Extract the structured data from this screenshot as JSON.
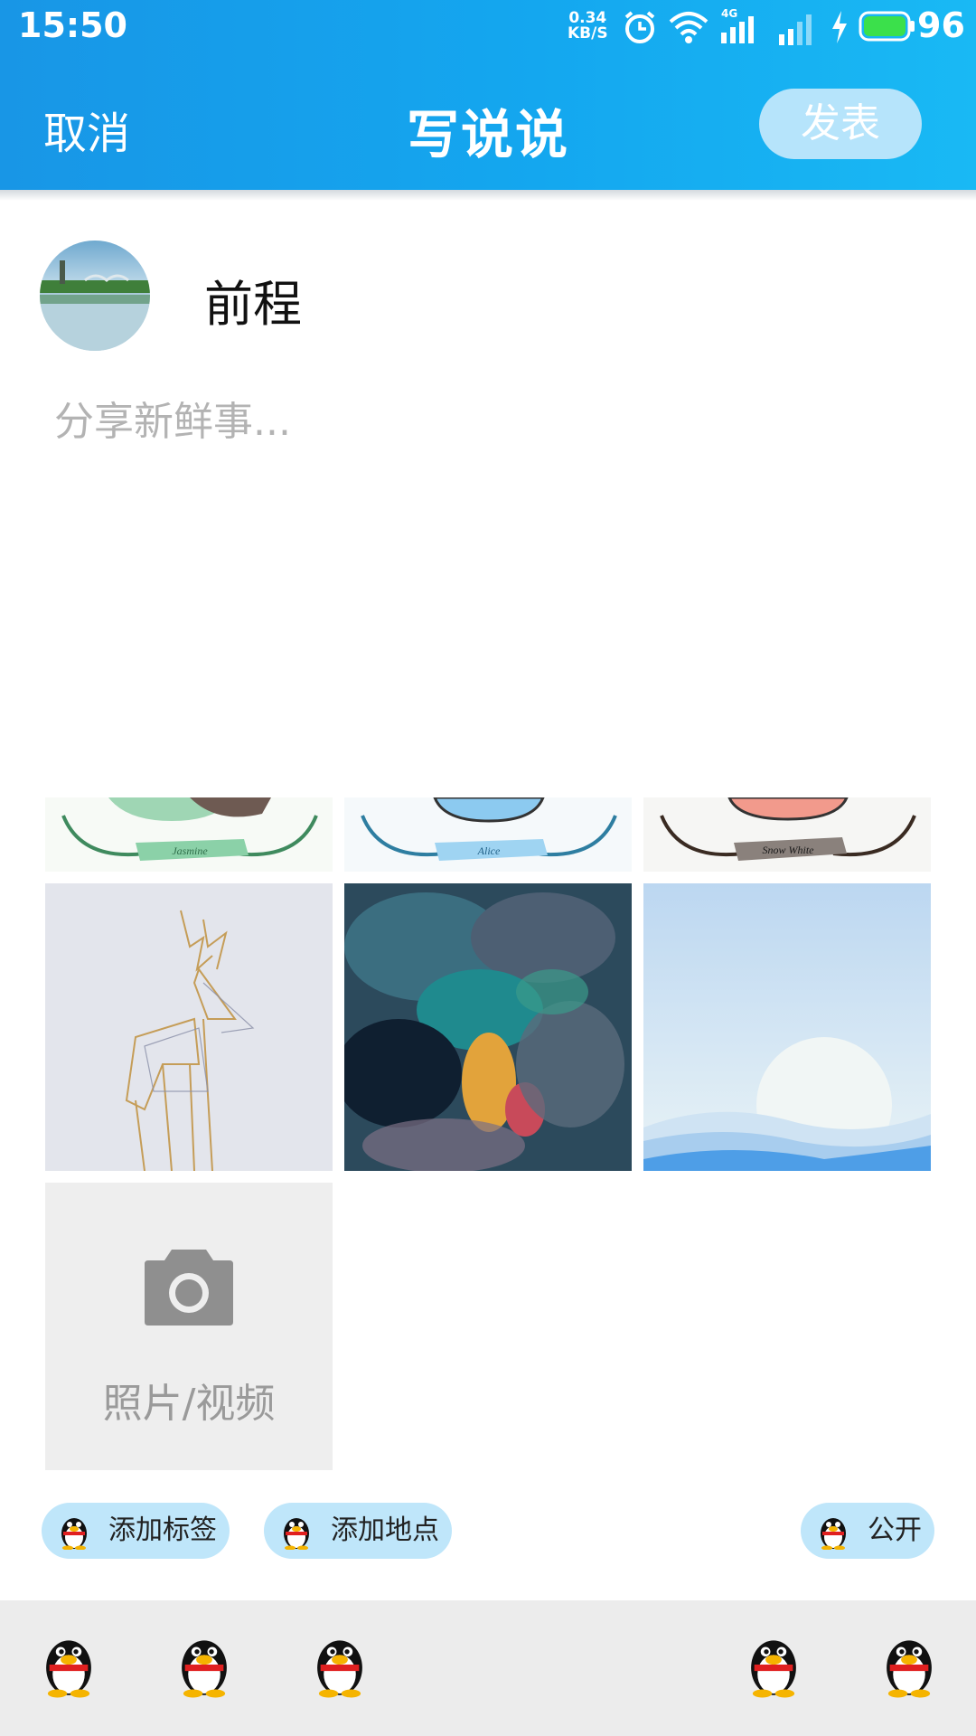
{
  "status_bar": {
    "time": "15:50",
    "net_speed_value": "0.34",
    "net_speed_unit": "KB/S",
    "network_type": "4G",
    "battery": "96",
    "icons": [
      "alarm-icon",
      "wifi-icon",
      "signal-4g-icon",
      "signal-icon",
      "charging-icon",
      "battery-icon"
    ]
  },
  "header": {
    "cancel_label": "取消",
    "title": "写说说",
    "publish_label": "发表"
  },
  "user": {
    "name": "前程"
  },
  "composer": {
    "placeholder": "分享新鲜事..."
  },
  "photos": {
    "banner_labels": [
      "Jasmine",
      "Alice",
      "Snow White"
    ],
    "add_media_label": "照片/视频"
  },
  "options": {
    "add_tag": "添加标签",
    "add_location": "添加地点",
    "visibility": "公开"
  },
  "emoji_bar": {
    "icons": [
      "penguin-icon",
      "penguin-icon",
      "penguin-icon",
      "penguin-icon",
      "penguin-icon"
    ]
  },
  "colors": {
    "header_blue": "#14a7ef",
    "pill_blue": "#bfe6fa",
    "publish_button_bg": "#b6e4fb"
  }
}
